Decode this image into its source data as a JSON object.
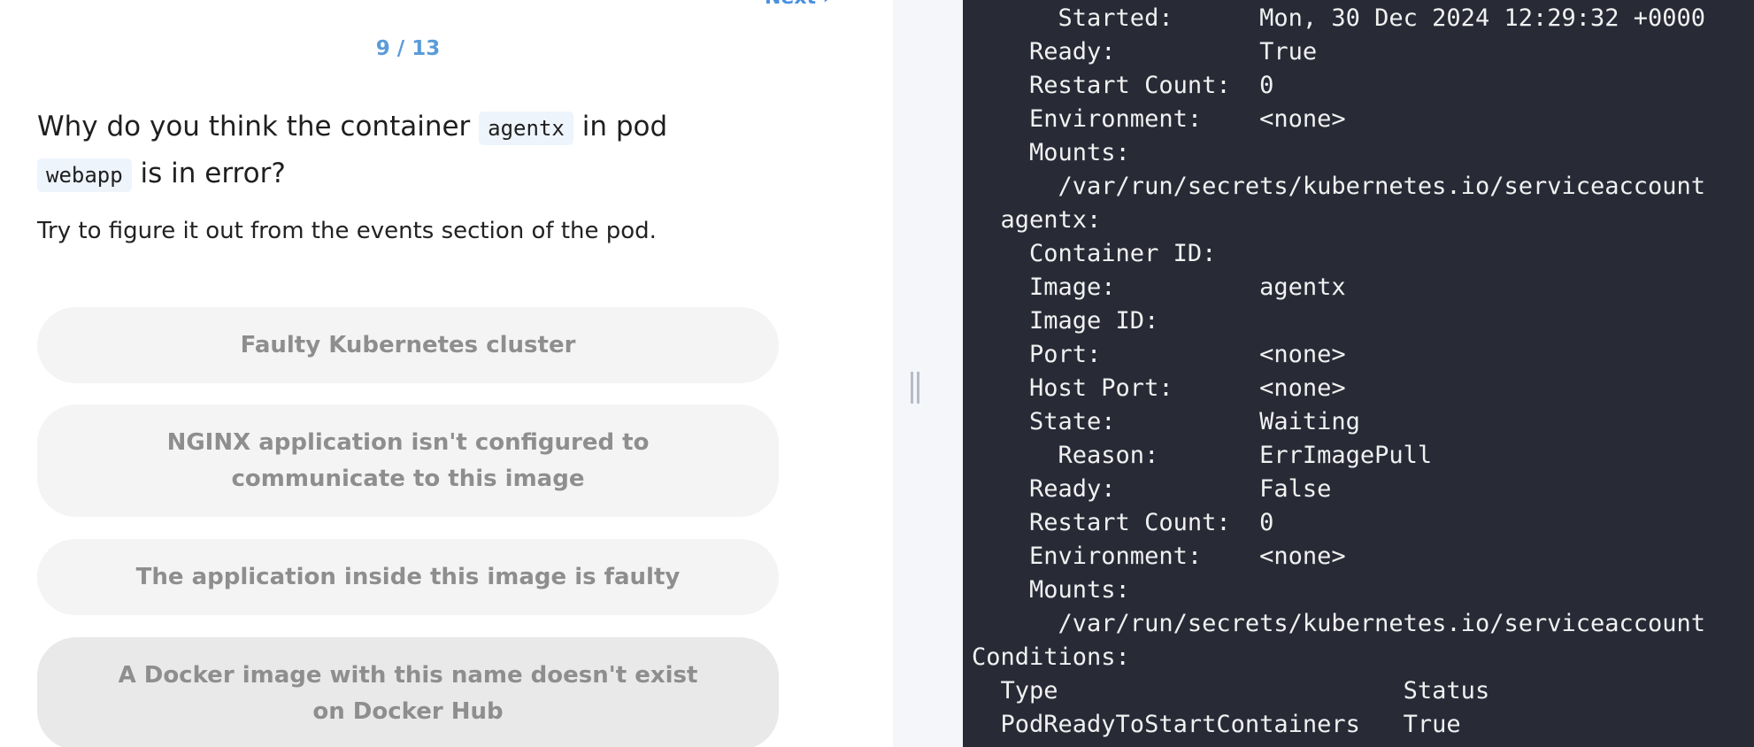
{
  "quiz": {
    "next_label": "Next",
    "progress": "9 / 13",
    "question": {
      "part1": "Why do you think the container ",
      "code1": "agentx",
      "part2": " in pod ",
      "code2": "webapp",
      "part3": " is in error?"
    },
    "hint": "Try to figure it out from the events section of the pod.",
    "answers": [
      "Faulty Kubernetes cluster",
      "NGINX application isn't configured to communicate to this image",
      "The application inside this image is faulty",
      "A Docker image with this name doesn't exist on Docker Hub"
    ]
  },
  "terminal": {
    "lines": [
      "      Started:      Mon, 30 Dec 2024 12:29:32 +0000",
      "    Ready:          True",
      "    Restart Count:  0",
      "    Environment:    <none>",
      "    Mounts:",
      "      /var/run/secrets/kubernetes.io/serviceaccount",
      "  agentx:",
      "    Container ID:",
      "    Image:          agentx",
      "    Image ID:",
      "    Port:           <none>",
      "    Host Port:      <none>",
      "    State:          Waiting",
      "      Reason:       ErrImagePull",
      "    Ready:          False",
      "    Restart Count:  0",
      "    Environment:    <none>",
      "    Mounts:",
      "      /var/run/secrets/kubernetes.io/serviceaccount",
      "Conditions:",
      "  Type                        Status",
      "  PodReadyToStartContainers   True"
    ]
  }
}
